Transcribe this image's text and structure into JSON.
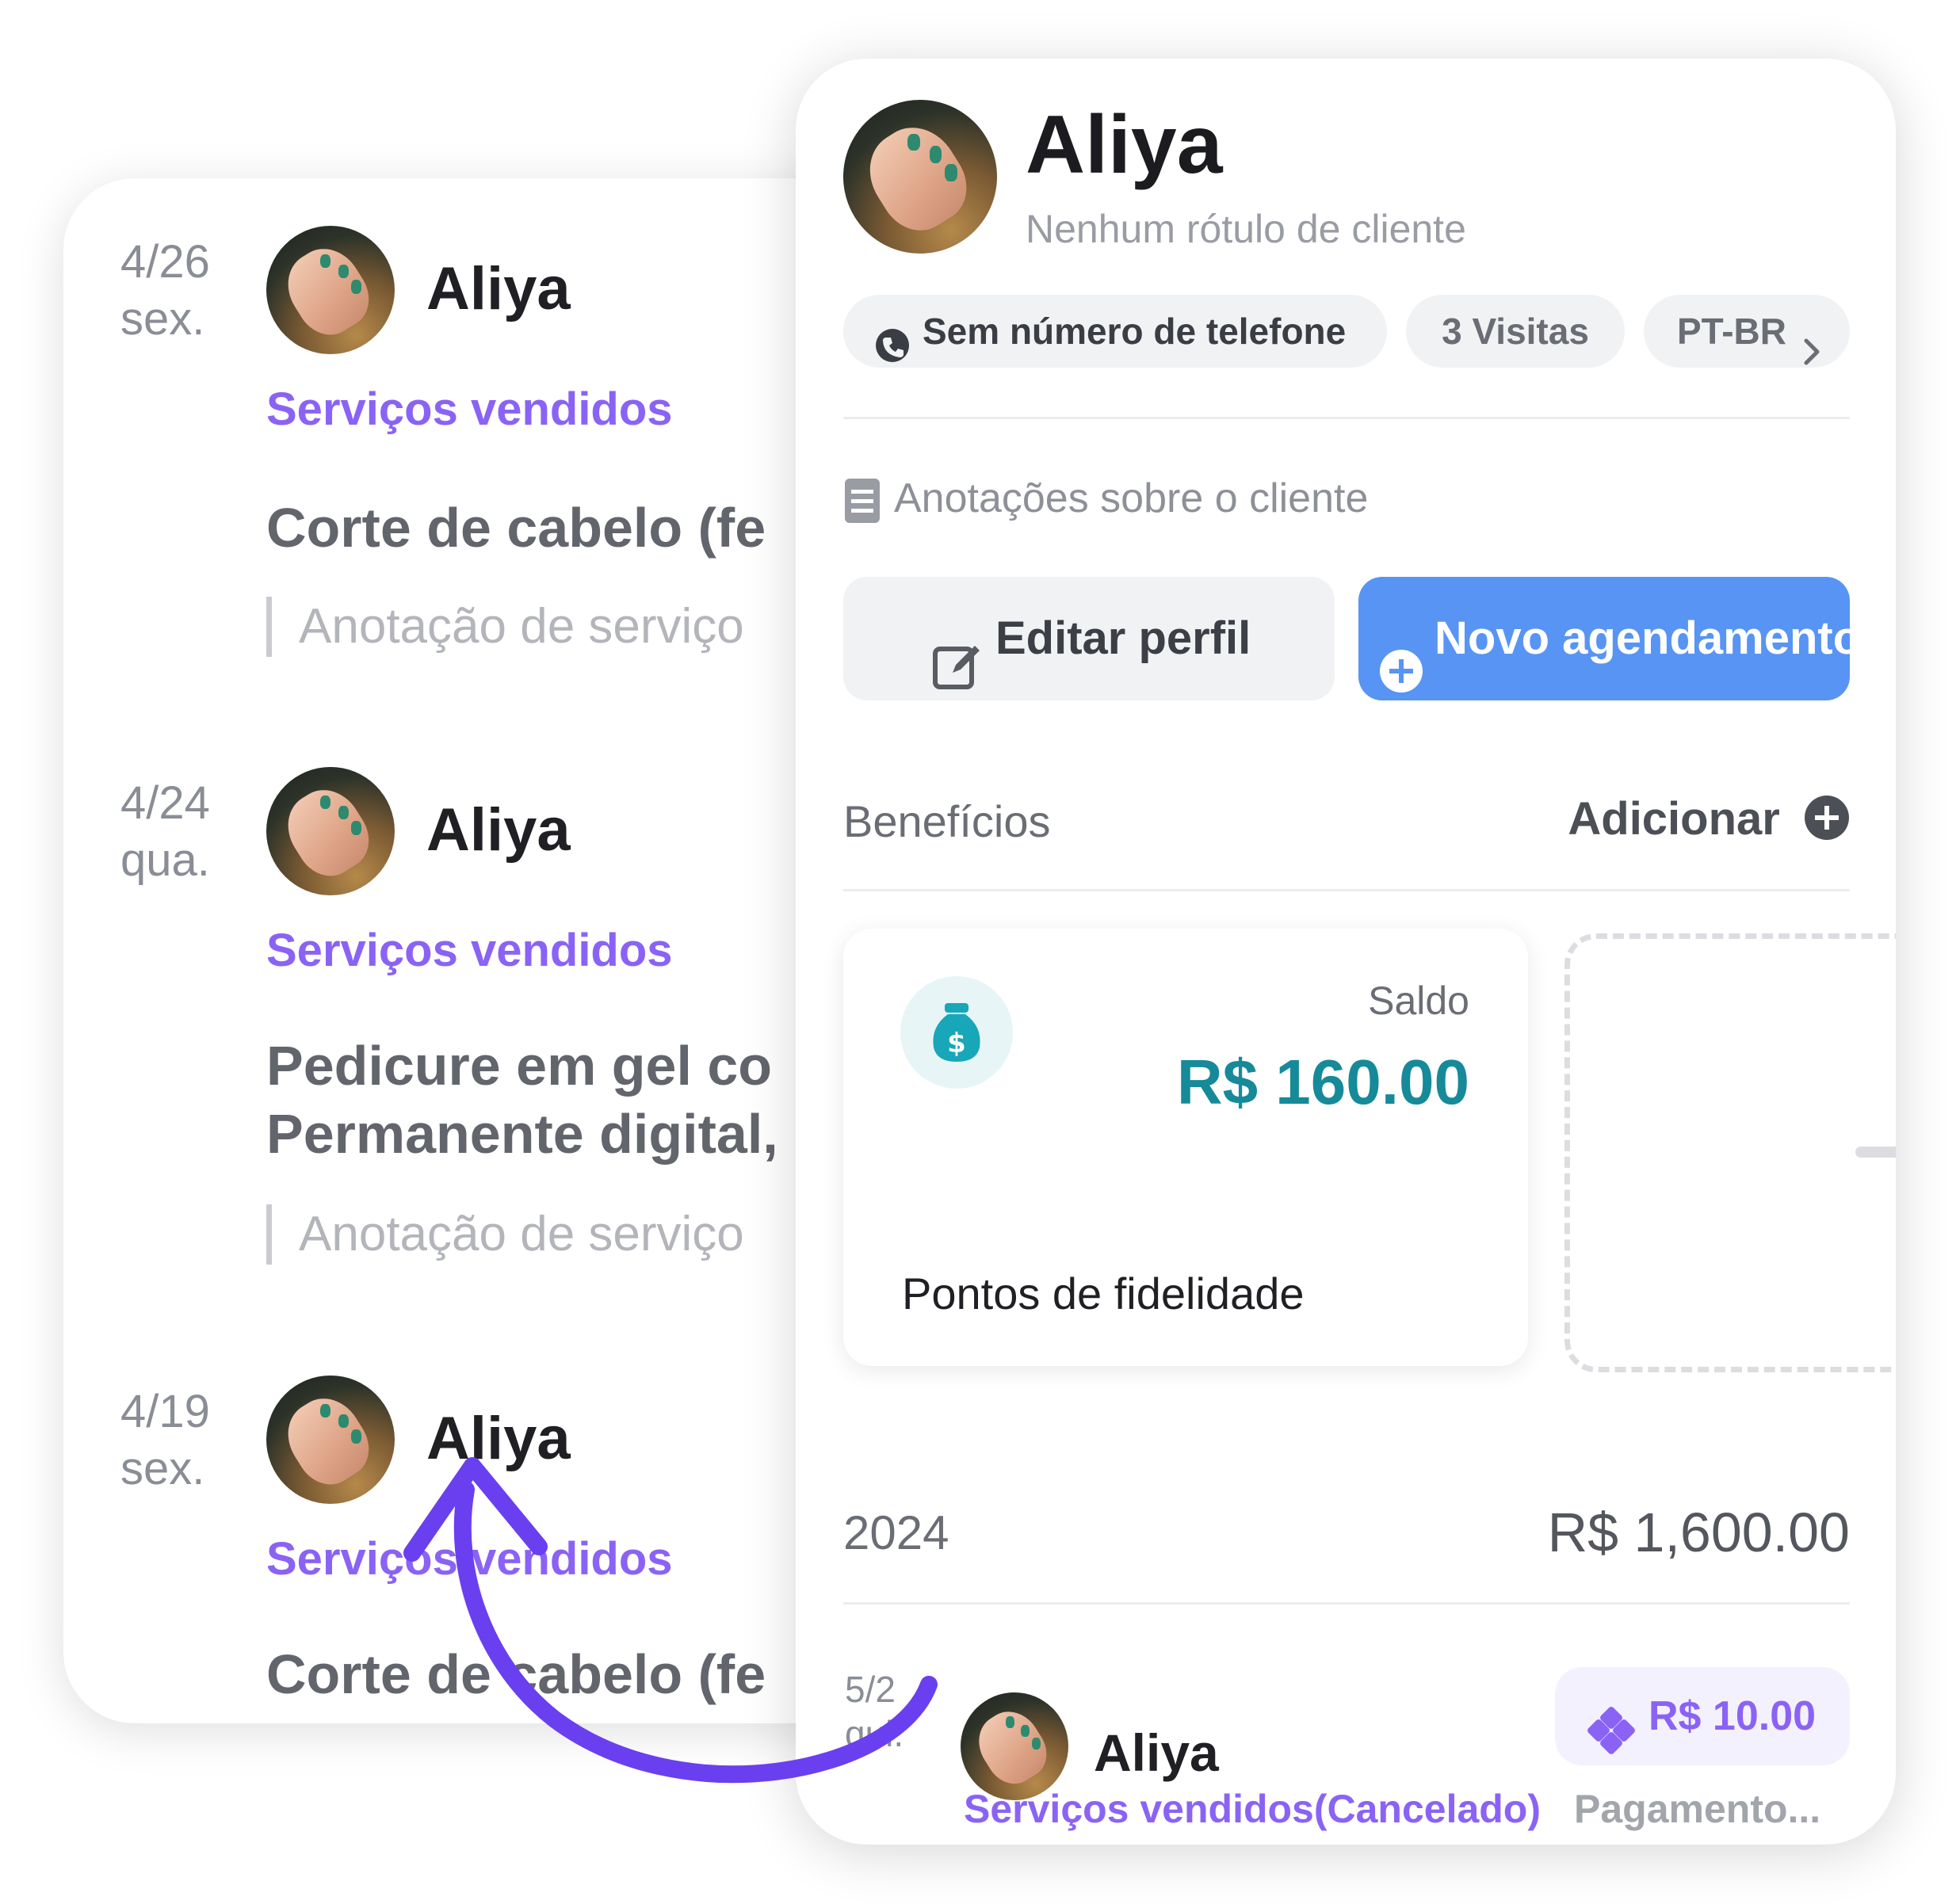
{
  "timeline": {
    "entries": [
      {
        "date": "4/26",
        "weekday": "sex.",
        "client_name": "Aliya",
        "service_type": "Serviços vendidos",
        "service_title_lines": [
          "Corte de cabelo (fe"
        ],
        "service_note": "Anotação de serviço"
      },
      {
        "date": "4/24",
        "weekday": "qua.",
        "client_name": "Aliya",
        "service_type": "Serviços vendidos",
        "service_title_lines": [
          "Pedicure em gel co",
          "Permanente digital,"
        ],
        "service_note": "Anotação de serviço"
      },
      {
        "date": "4/19",
        "weekday": "sex.",
        "client_name": "Aliya",
        "service_type": "Serviços vendidos",
        "service_title_lines": [
          "Corte de cabelo (fe"
        ]
      }
    ]
  },
  "profile": {
    "name": "Aliya",
    "label": "Nenhum rótulo de cliente",
    "chips": {
      "phone": "Sem número de telefone",
      "visits": "3 Visitas",
      "language": "PT-BR"
    },
    "notes_placeholder": "Anotações sobre o cliente",
    "edit_button": "Editar perfil",
    "new_button": "Novo agendamento"
  },
  "benefits": {
    "title": "Benefícios",
    "add_label": "Adicionar",
    "card": {
      "balance_label": "Saldo",
      "balance_value": "R$ 160.00",
      "name": "Pontos de fidelidade"
    }
  },
  "history": {
    "year": "2024",
    "year_total": "R$ 1,600.00",
    "transaction": {
      "date": "5/2",
      "weekday": "qui.",
      "client_name": "Aliya",
      "amount": "R$ 10.00",
      "status": "Serviços vendidos(Cancelado)",
      "payment": "Pagamento..."
    }
  },
  "colors": {
    "accent_purple": "#8a63f5",
    "primary_blue": "#5894f3",
    "teal": "#168a99",
    "arrow_purple": "#6a3ff0"
  },
  "icons": [
    "phone-icon",
    "chevron-right-icon",
    "notes-icon",
    "edit-icon",
    "plus-circle-icon",
    "money-bag-icon",
    "diamond-icon",
    "curved-arrow-icon"
  ]
}
